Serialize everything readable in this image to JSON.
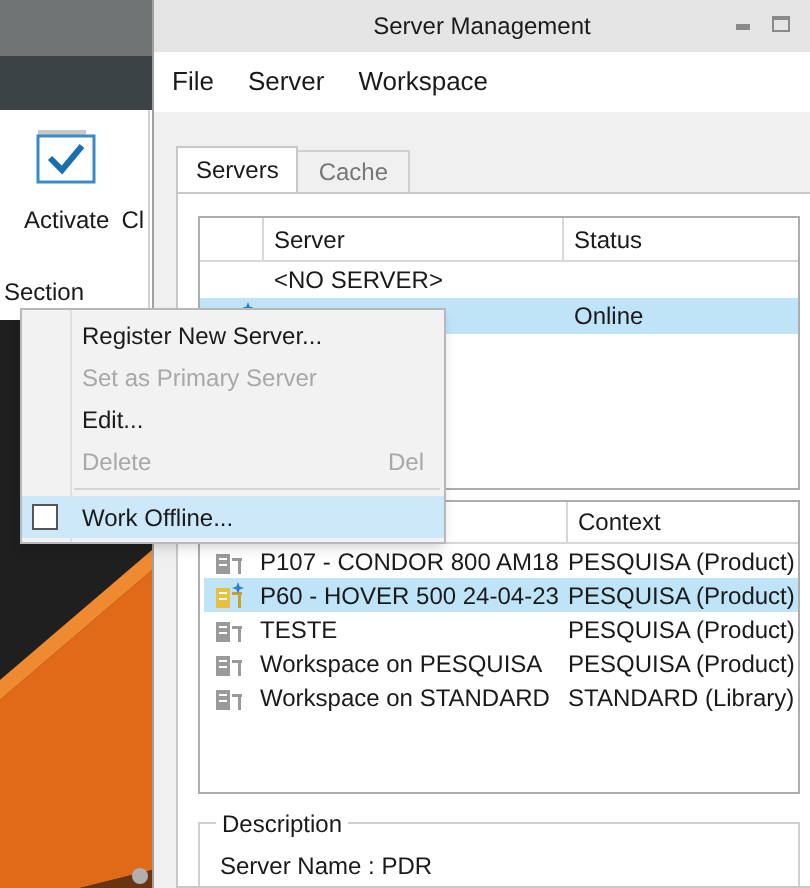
{
  "app": {
    "ribbon": {
      "buttons": [
        {
          "label": "Activate"
        },
        {
          "label": "Cl"
        }
      ],
      "group_label": "Section"
    }
  },
  "dialog": {
    "title": "Server Management",
    "menu": [
      "File",
      "Server",
      "Workspace"
    ],
    "tabs": [
      {
        "label": "Servers",
        "selected": true
      },
      {
        "label": "Cache",
        "selected": false
      }
    ],
    "servers": {
      "columns": [
        "Server",
        "Status"
      ],
      "rows": [
        {
          "server": "<NO SERVER>",
          "selected": false,
          "primary": false
        },
        {
          "status": "Online",
          "selected": true,
          "primary": true
        }
      ]
    },
    "workspaces": {
      "columns": [
        "Context"
      ],
      "rows": [
        {
          "name": "P107 - CONDOR 800 AM18",
          "context": "PESQUISA (Product)",
          "selected": false,
          "active": false
        },
        {
          "name": "P60 - HOVER 500 24-04-23",
          "context": "PESQUISA (Product)",
          "selected": true,
          "active": true
        },
        {
          "name": "TESTE",
          "context": "PESQUISA (Product)",
          "selected": false,
          "active": false
        },
        {
          "name": "Workspace on PESQUISA",
          "context": "PESQUISA (Product)",
          "selected": false,
          "active": false
        },
        {
          "name": "Workspace on STANDARD",
          "context": "STANDARD (Library)",
          "selected": false,
          "active": false
        }
      ]
    },
    "description": {
      "title": "Description",
      "lines": [
        "Server Name : PDR"
      ]
    }
  },
  "context_menu": {
    "items": [
      {
        "kind": "item",
        "label": "Register New Server...",
        "disabled": false,
        "highlighted": false
      },
      {
        "kind": "item",
        "label": "Set as Primary Server",
        "disabled": true,
        "highlighted": false
      },
      {
        "kind": "item",
        "label": "Edit...",
        "disabled": false,
        "highlighted": false
      },
      {
        "kind": "item",
        "label": "Delete",
        "shortcut": "Del",
        "disabled": true,
        "highlighted": false
      },
      {
        "kind": "separator"
      },
      {
        "kind": "check",
        "label": "Work Offline...",
        "checked": false,
        "disabled": false,
        "highlighted": true
      }
    ]
  }
}
